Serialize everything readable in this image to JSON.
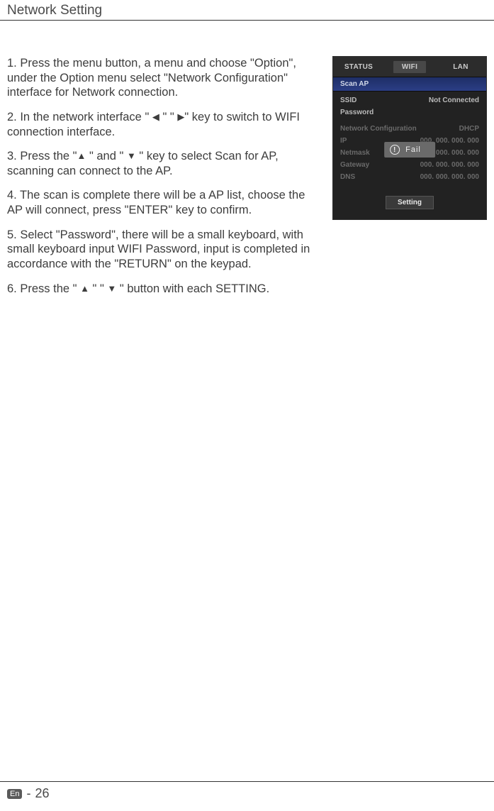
{
  "header": {
    "title": "Network Setting"
  },
  "instructions": {
    "p1": "1. Press the menu button, a menu and choose \"Option\", under the Option menu select \"Network Configuration\" interface for Network connection.",
    "p2_pre": "2. In the network interface \" ",
    "p2_mid": " \" \"  ",
    "p2_post": "\" key to switch to WIFI connection interface.",
    "p3_a": "3. Press the \"",
    "p3_b": " \" and \" ",
    "p3_c": " \" key to select Scan for AP, scanning can connect to the AP.",
    "p4": "4. The scan is complete there will be a AP list, choose the AP will connect, press \"ENTER\" key to confirm.",
    "p5": "5. Select \"Password\", there will be a small keyboard, with small keyboard input WIFI Password, input is completed in accordance with the \"RETURN\" on the keypad.",
    "p6_a": "6. Press the \" ",
    "p6_b": " \" \" ",
    "p6_c": " \" button with each SETTING."
  },
  "panel": {
    "tabs": {
      "status": "STATUS",
      "wifi": "WIFI",
      "lan": "LAN"
    },
    "scan_ap": "Scan AP",
    "ssid_label": "SSID",
    "ssid_value": "Not Connected",
    "password_label": "Password",
    "netconf_label": "Network Configuration",
    "netconf_value": "DHCP",
    "ip_label": "IP",
    "ip_value": "000. 000. 000. 000",
    "netmask_label": "Netmask",
    "netmask_value": "000. 000. 000. 000",
    "gateway_label": "Gateway",
    "gateway_value": "000. 000. 000. 000",
    "dns_label": "DNS",
    "dns_value": "000. 000. 000. 000",
    "setting_btn": "Setting",
    "overlay_text": "Fail"
  },
  "footer": {
    "lang": "En",
    "sep": "-",
    "page": "26"
  }
}
